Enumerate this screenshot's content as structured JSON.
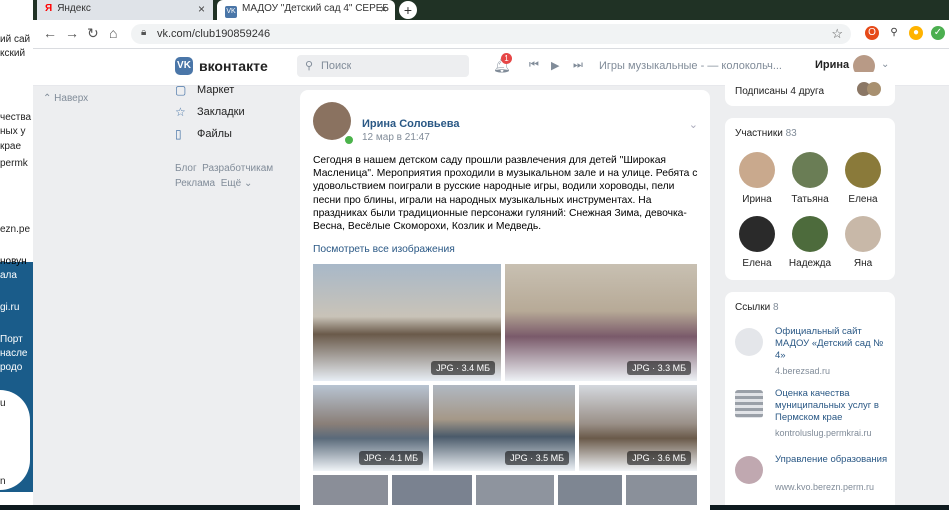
{
  "browser": {
    "tabs": [
      {
        "label": "Яндекс",
        "icon": "yandex-icon"
      },
      {
        "label": "МАДОУ \"Детский сад 4\" СЕРЕБ",
        "icon": "vk-icon"
      }
    ],
    "url": "vk.com/club190859246"
  },
  "background_fragments": [
    "ий сай",
    "кский",
    "чества",
    "ных у",
    "крае",
    "permk",
    "ezn.pe",
    "новун",
    "ала",
    "gi.ru",
    "Порт",
    "насле",
    "родо",
    "u",
    "n"
  ],
  "vk": {
    "logo": "вконтакте",
    "search_placeholder": "Поиск",
    "notification_count": "1",
    "track": "Игры музыкальные - — колокольч...",
    "user_name": "Ирина"
  },
  "back_label": "Наверх",
  "left_menu": {
    "items": [
      {
        "label": "Маркет",
        "icon": "market-icon"
      },
      {
        "label": "Закладки",
        "icon": "star-icon"
      },
      {
        "label": "Файлы",
        "icon": "file-icon"
      }
    ],
    "footer": [
      "Блог",
      "Разработчикам",
      "Реклама",
      "Ещё"
    ]
  },
  "post": {
    "author": "Ирина Соловьева",
    "date": "12 мар в 21:47",
    "text": "Сегодня в нашем детском саду прошли развлечения для детей \"Широкая Масленица\". Мероприятия проходили в музыкальном зале и на улице. Ребята с удовольствием поиграли в русские народные игры, водили хороводы, пели песни про блины, играли на народных музыкальных инструментах. На праздниках были традиционные персонажи гуляний: Снежная Зима, девочка-Весна, Весёлые Скоморохи, Козлик и Медведь.",
    "more_link": "Посмотреть все изображения",
    "photos": [
      {
        "label": "JPG · 3.4 МБ"
      },
      {
        "label": "JPG · 3.3 МБ"
      },
      {
        "label": "JPG · 4.1 МБ"
      },
      {
        "label": "JPG · 3.5 МБ"
      },
      {
        "label": "JPG · 3.6 МБ"
      }
    ]
  },
  "friends_card": {
    "subscribed": "Подписаны 4 друга"
  },
  "members": {
    "title": "Участники",
    "count": "83",
    "people": [
      "Ирина",
      "Татьяна",
      "Елена",
      "Елена",
      "Надежда",
      "Яна"
    ],
    "colors": [
      "#c9a98d",
      "#6a7d55",
      "#8a7a3a",
      "#2a2a2a",
      "#4d6b3c",
      "#c8b8a8"
    ]
  },
  "links": {
    "title": "Ссылки",
    "count": "8",
    "items": [
      {
        "title": "Официальный сайт МАДОУ «Детский сад № 4»",
        "url": "4.berezsad.ru"
      },
      {
        "title": "Оценка качества муниципальных услуг в Пермском крае",
        "url": "kontroluslug.permkrai.ru"
      },
      {
        "title": "Управление образования",
        "url": "www.kvo.berezn.perm.ru"
      }
    ]
  }
}
